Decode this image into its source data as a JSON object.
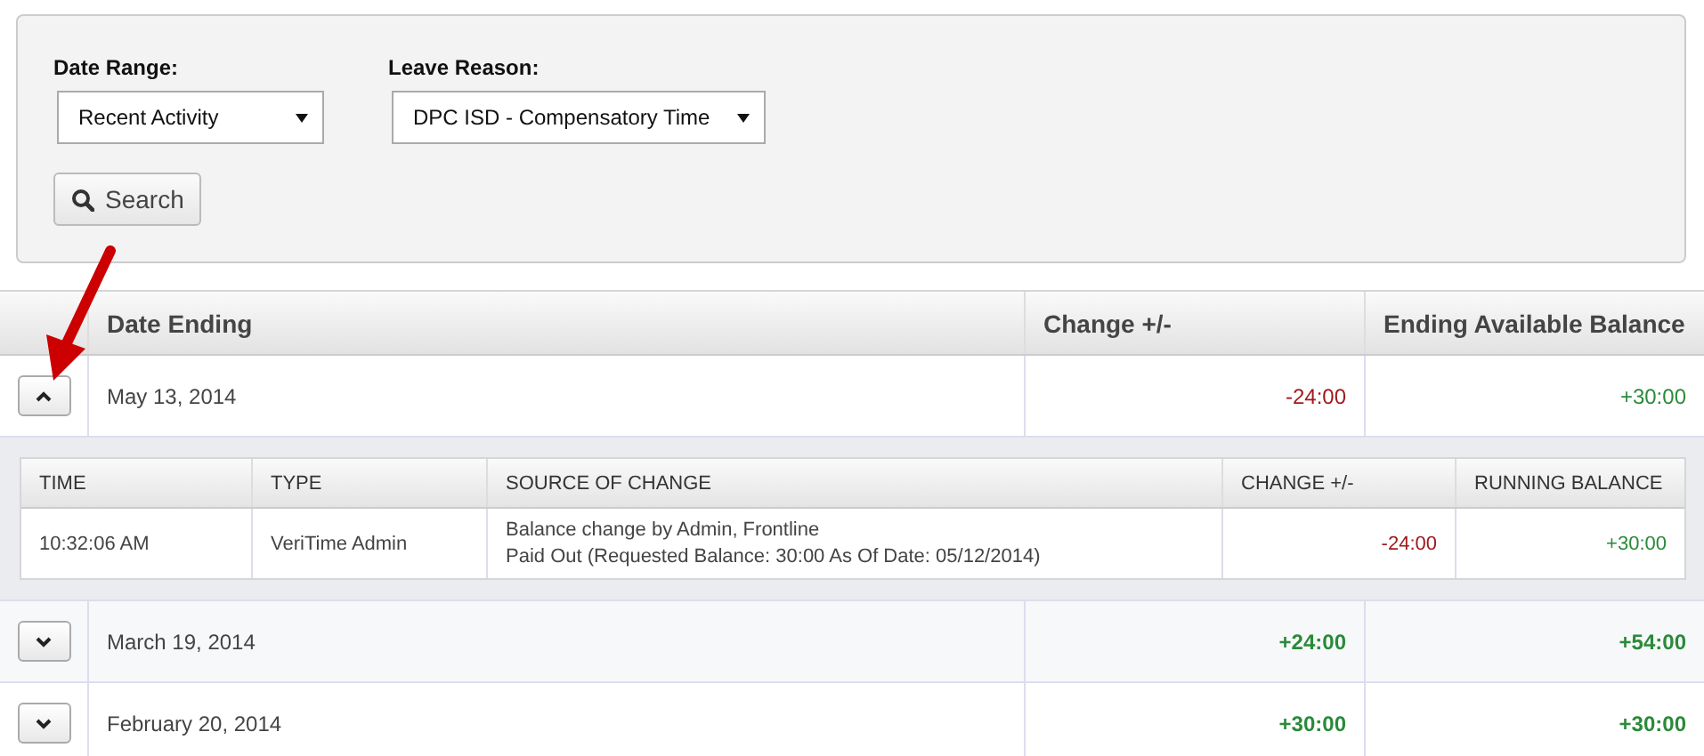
{
  "filters": {
    "date_range": {
      "label": "Date Range:",
      "value": "Recent Activity"
    },
    "leave_reason": {
      "label": "Leave Reason:",
      "value": "DPC ISD - Compensatory Time"
    },
    "search_button": "Search"
  },
  "table": {
    "columns": [
      "Date Ending",
      "Change +/-",
      "Ending Available Balance"
    ],
    "rows": [
      {
        "date": "May 13, 2014",
        "expanded": true,
        "change": {
          "text": "-24:00",
          "kind": "negative"
        },
        "balance": {
          "text": "+30:00",
          "kind": "positive"
        },
        "details": {
          "columns": [
            "TIME",
            "TYPE",
            "SOURCE OF CHANGE",
            "CHANGE +/-",
            "RUNNING BALANCE"
          ],
          "rows": [
            {
              "time": "10:32:06 AM",
              "type": "VeriTime Admin",
              "source": [
                "Balance change by Admin, Frontline",
                "Paid Out (Requested Balance: 30:00 As Of Date: 05/12/2014)"
              ],
              "change": {
                "text": "-24:00",
                "kind": "negative"
              },
              "running_balance": {
                "text": "+30:00",
                "kind": "positive"
              }
            }
          ]
        }
      },
      {
        "date": "March 19, 2014",
        "expanded": false,
        "change": {
          "text": "+24:00",
          "kind": "positive"
        },
        "balance": {
          "text": "+54:00",
          "kind": "positive"
        }
      },
      {
        "date": "February 20, 2014",
        "expanded": false,
        "change": {
          "text": "+30:00",
          "kind": "positive"
        },
        "balance": {
          "text": "+30:00",
          "kind": "positive"
        }
      }
    ]
  }
}
